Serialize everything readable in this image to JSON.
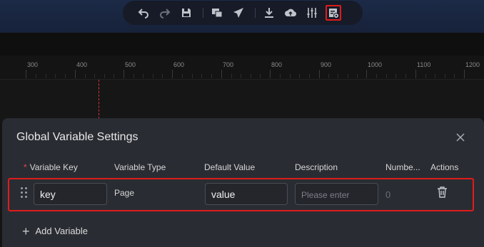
{
  "toolbar": {
    "icons": [
      "undo-icon",
      "redo-icon",
      "save-icon",
      "preview-icon",
      "publish-icon",
      "download-icon",
      "upload-icon",
      "settings-sliders-icon",
      "global-variable-icon"
    ]
  },
  "ruler": {
    "ticks": [
      "300",
      "400",
      "500",
      "600",
      "700",
      "800",
      "900",
      "1000",
      "1100",
      "1200"
    ]
  },
  "modal": {
    "title": "Global Variable Settings",
    "columns": {
      "key": "Variable Key",
      "type": "Variable Type",
      "default": "Default Value",
      "description": "Description",
      "number": "Numbe...",
      "actions": "Actions"
    },
    "required_mark": "*",
    "row": {
      "key": "key",
      "type": "Page",
      "default_value": "value",
      "description_placeholder": "Please enter",
      "number": "0"
    },
    "add_label": "Add Variable"
  },
  "colors": {
    "highlight": "#e01b1b",
    "modal_bg": "#2a2c33",
    "toolbar_bg": "#161b27"
  }
}
